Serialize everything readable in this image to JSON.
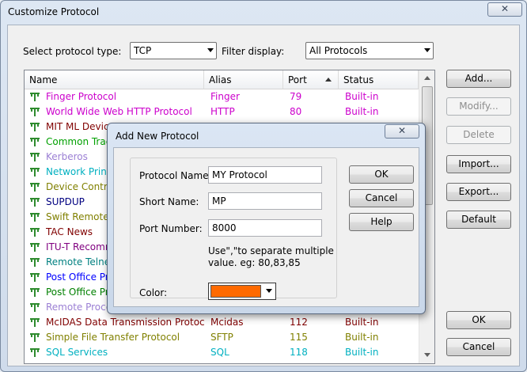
{
  "window": {
    "title": "Customize Protocol",
    "close_glyph": "✕",
    "protocol_type_label": "Select protocol type:",
    "protocol_type_value": "TCP",
    "filter_label": "Filter display:",
    "filter_value": "All Protocols"
  },
  "table": {
    "columns": [
      "Name",
      "Alias",
      "Port",
      "Status"
    ],
    "sort_column": "Port",
    "rows": [
      {
        "name": "Finger Protocol",
        "alias": "Finger",
        "port": "79",
        "status": "Built-in",
        "color": "#cc00cc"
      },
      {
        "name": "World Wide Web HTTP Protocol",
        "alias": "HTTP",
        "port": "80",
        "status": "Built-in",
        "color": "#cc00cc"
      },
      {
        "name": "MIT ML Device",
        "alias": "",
        "port": "",
        "status": "",
        "color": "#800000"
      },
      {
        "name": "Common Trace",
        "alias": "",
        "port": "",
        "status": "",
        "color": "#00a000"
      },
      {
        "name": "Kerberos",
        "alias": "",
        "port": "",
        "status": "",
        "color": "#9b7fd4"
      },
      {
        "name": "Network Printin",
        "alias": "",
        "port": "",
        "status": "",
        "color": "#00b0c0"
      },
      {
        "name": "Device Control",
        "alias": "",
        "port": "",
        "status": "",
        "color": "#808000"
      },
      {
        "name": "SUPDUP",
        "alias": "",
        "port": "",
        "status": "",
        "color": "#000080"
      },
      {
        "name": "Swift Remote V",
        "alias": "",
        "port": "",
        "status": "",
        "color": "#808000"
      },
      {
        "name": "TAC News",
        "alias": "",
        "port": "",
        "status": "",
        "color": "#800000"
      },
      {
        "name": "ITU-T Recomm",
        "alias": "",
        "port": "",
        "status": "",
        "color": "#800080"
      },
      {
        "name": "Remote Telnet",
        "alias": "",
        "port": "",
        "status": "",
        "color": "#008080"
      },
      {
        "name": "Post Office Prot",
        "alias": "",
        "port": "",
        "status": "",
        "color": "#0000ff"
      },
      {
        "name": "Post Office Prot",
        "alias": "",
        "port": "",
        "status": "",
        "color": "#008000"
      },
      {
        "name": "Remote Proced",
        "alias": "",
        "port": "",
        "status": "",
        "color": "#9b7fd4"
      },
      {
        "name": "McIDAS Data Transmission Protocol",
        "alias": "Mcidas",
        "port": "112",
        "status": "Built-in",
        "color": "#800000"
      },
      {
        "name": "Simple File Transfer Protocol",
        "alias": "SFTP",
        "port": "115",
        "status": "Built-in",
        "color": "#808000"
      },
      {
        "name": "SQL Services",
        "alias": "SQL",
        "port": "118",
        "status": "Built-in",
        "color": "#00b0c0"
      }
    ]
  },
  "buttons": {
    "add": "Add...",
    "modify": "Modify...",
    "delete": "Delete",
    "import": "Import...",
    "export": "Export...",
    "default": "Default",
    "ok": "OK",
    "cancel": "Cancel"
  },
  "modal": {
    "title": "Add New Protocol",
    "close_glyph": "✕",
    "name_label": "Protocol Name:",
    "name_value": "MY Protocol",
    "short_label": "Short Name:",
    "short_value": "MP",
    "port_label": "Port Number:",
    "port_value": "8000",
    "note": "Use\",\"to separate multiple value. eg: 80,83,85",
    "color_label": "Color:",
    "color_value": "#ff6a00",
    "ok": "OK",
    "cancel": "Cancel",
    "help": "Help"
  },
  "icons": {
    "protocol": "protocol-tree-icon"
  }
}
